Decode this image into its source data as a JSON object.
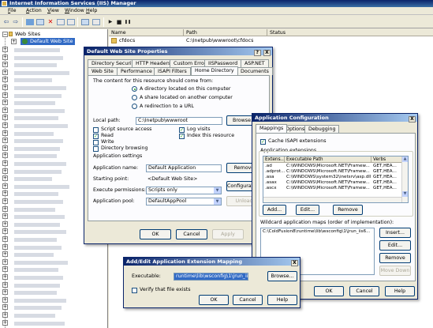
{
  "window": {
    "title": "Internet Information Services (IIS) Manager"
  },
  "menu": [
    "File",
    "Action",
    "View",
    "Window",
    "Help"
  ],
  "toolbar": {
    "icons": [
      "back-icon",
      "forward-icon",
      "up-icon",
      "properties-icon",
      "delete-icon",
      "refresh-icon",
      "export-icon",
      "help-icon",
      "console-icon",
      "run-icon",
      "stop-icon",
      "pause-icon"
    ],
    "glyphs": {
      "back": "⇦",
      "forward": "⇨",
      "play": "▶",
      "stop": "■",
      "pause": "❚❚"
    }
  },
  "tree": {
    "root": "Web Sites",
    "selected": "Default Web Site",
    "expand_glyph": "+",
    "collapse_glyph": "−"
  },
  "list": {
    "columns": [
      "Name",
      "Path",
      "Status"
    ],
    "rows": [
      {
        "name": "cfdocs",
        "path": "C:\\Inetpub\\wwwroot\\cfdocs",
        "status": ""
      }
    ]
  },
  "site_props": {
    "title": "Default Web Site Properties",
    "title_buttons": [
      "?",
      "X"
    ],
    "tabs_row1": [
      "Directory Security",
      "HTTP Headers",
      "Custom Errors",
      "IISPassword",
      "ASP.NET"
    ],
    "tabs_row2": [
      "Web Site",
      "Performance",
      "ISAPI Filters",
      "Home Directory",
      "Documents"
    ],
    "content_from_label": "The content for this resource should come from:",
    "radio_options": [
      "A directory located on this computer",
      "A share located on another computer",
      "A redirection to a URL"
    ],
    "local_path_label": "Local path:",
    "local_path_value": "C:\\Inetpub\\wwwroot",
    "browse_button": "Browse...",
    "checks": {
      "script_source": "Script source access",
      "read": "Read",
      "write": "Write",
      "dir_browsing": "Directory browsing",
      "log_visits": "Log visits",
      "index": "Index this resource"
    },
    "app_settings_label": "Application settings",
    "app_name_label": "Application name:",
    "app_name_value": "Default Application",
    "remove_button": "Remove",
    "starting_point_label": "Starting point:",
    "starting_point_value": "<Default Web Site>",
    "configuration_button": "Configuration...",
    "exec_perms_label": "Execute permissions:",
    "exec_perms_value": "Scripts only",
    "app_pool_label": "Application pool:",
    "app_pool_value": "DefaultAppPool",
    "unload_button": "Unload",
    "ok": "OK",
    "cancel": "Cancel",
    "apply": "Apply",
    "help": "Help"
  },
  "app_config": {
    "title": "Application Configuration",
    "close": "X",
    "tabs": [
      "Mappings",
      "Options",
      "Debugging"
    ],
    "cache_isapi": "Cache ISAPI extensions",
    "app_ext_label": "Application extensions",
    "table_headers": [
      "Extens...",
      "Executable Path",
      "Verbs"
    ],
    "rows": [
      {
        "ext": ".ad",
        "path": "C:\\WINDOWS\\Microsoft.NET\\Framew...",
        "verbs": "GET,HEA..."
      },
      {
        "ext": ".adprot...",
        "path": "C:\\WINDOWS\\Microsoft.NET\\Framew...",
        "verbs": "GET,HEA..."
      },
      {
        "ext": ".asa",
        "path": "C:\\WINDOWS\\system32\\inetsrv\\asp.dll",
        "verbs": "GET,HEA..."
      },
      {
        "ext": ".asax",
        "path": "C:\\WINDOWS\\Microsoft.NET\\Framew...",
        "verbs": "GET,HEA..."
      },
      {
        "ext": ".ascx",
        "path": "C:\\WINDOWS\\Microsoft.NET\\Framew...",
        "verbs": "GET,HEA..."
      }
    ],
    "add": "Add...",
    "edit": "Edit...",
    "remove": "Remove",
    "wildcard_label": "Wildcard application maps (order of implementation):",
    "wildcard_value": "C:\\ColdFusion8\\runtime\\lib\\wsconfig\\1\\jrun_iis6...",
    "insert": "Insert...",
    "edit2": "Edit...",
    "remove2": "Remove",
    "move_down": "Move Down",
    "ok": "OK",
    "cancel": "Cancel",
    "help": "Help"
  },
  "ext_mapping": {
    "title": "Add/Edit Application Extension Mapping",
    "close": "X",
    "executable_label": "Executable:",
    "executable_value": "runtime\\lib\\wsconfig\\1\\jrun_iis6_wildcard.dll",
    "browse": "Browse...",
    "verify": "Verify that file exists",
    "ok": "OK",
    "cancel": "Cancel",
    "help": "Help"
  }
}
